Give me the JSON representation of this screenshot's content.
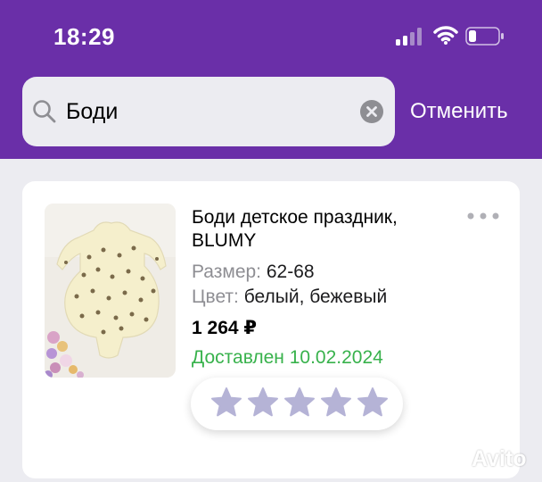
{
  "status_bar": {
    "time": "18:29",
    "icons": [
      "signal-icon",
      "wifi-icon",
      "battery-icon"
    ]
  },
  "search": {
    "query": "Боди",
    "cancel_label": "Отменить"
  },
  "product": {
    "title": "Боди детское праздник, BLUMY",
    "size_label": "Размер:",
    "size_value": "62-68",
    "color_label": "Цвет:",
    "color_value": "белый, бежевый",
    "price": "1 264 ₽",
    "delivery_status": "Доставлен 10.02.2024",
    "rating_stars_total": 5,
    "rating_stars_filled": 0
  },
  "watermark": {
    "text": "Avito"
  },
  "colors": {
    "header": "#6a2fa8",
    "delivered": "#38b24c",
    "star_empty": "#b5b3d6",
    "background": "#ececf1"
  }
}
